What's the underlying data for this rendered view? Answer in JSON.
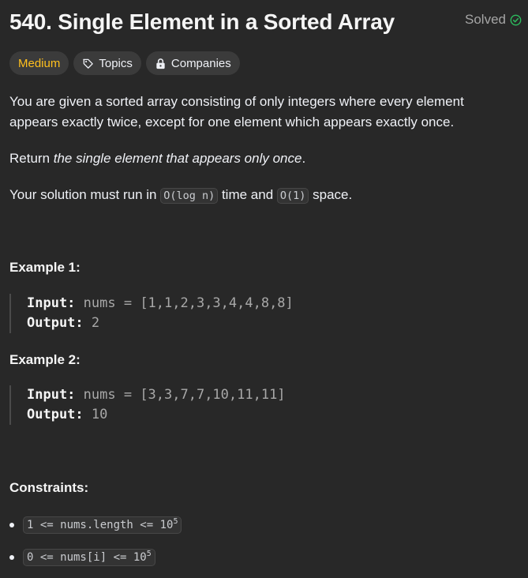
{
  "problem": {
    "title": "540. Single Element in a Sorted Array",
    "status": "Solved"
  },
  "tags": {
    "difficulty": "Medium",
    "topics": "Topics",
    "companies": "Companies"
  },
  "description": {
    "p1": "You are given a sorted array consisting of only integers where every element appears exactly twice, except for one element which appears exactly once.",
    "p2_prefix": "Return ",
    "p2_em": "the single element that appears only once",
    "p2_suffix": ".",
    "p3_prefix": "Your solution must run in ",
    "p3_code1": "O(log n)",
    "p3_mid": " time and ",
    "p3_code2": "O(1)",
    "p3_suffix": " space."
  },
  "examples": [
    {
      "title": "Example 1:",
      "input_label": "Input:",
      "input_value": "nums = [1,1,2,3,3,4,4,8,8]",
      "output_label": "Output:",
      "output_value": "2"
    },
    {
      "title": "Example 2:",
      "input_label": "Input:",
      "input_value": "nums = [3,3,7,7,10,11,11]",
      "output_label": "Output:",
      "output_value": "10"
    }
  ],
  "constraints": {
    "title": "Constraints:",
    "items": [
      {
        "text": "1 <= nums.length <= 10",
        "sup": "5"
      },
      {
        "text": "0 <= nums[i] <= 10",
        "sup": "5"
      }
    ]
  },
  "colors": {
    "background": "#282828",
    "medium": "#ffc01e",
    "solved_check": "#2cbb5d",
    "tag_bg": "#3b3b3b"
  },
  "icons": {
    "solved": "check-circle-icon",
    "topics": "tag-icon",
    "companies": "lock-icon"
  }
}
